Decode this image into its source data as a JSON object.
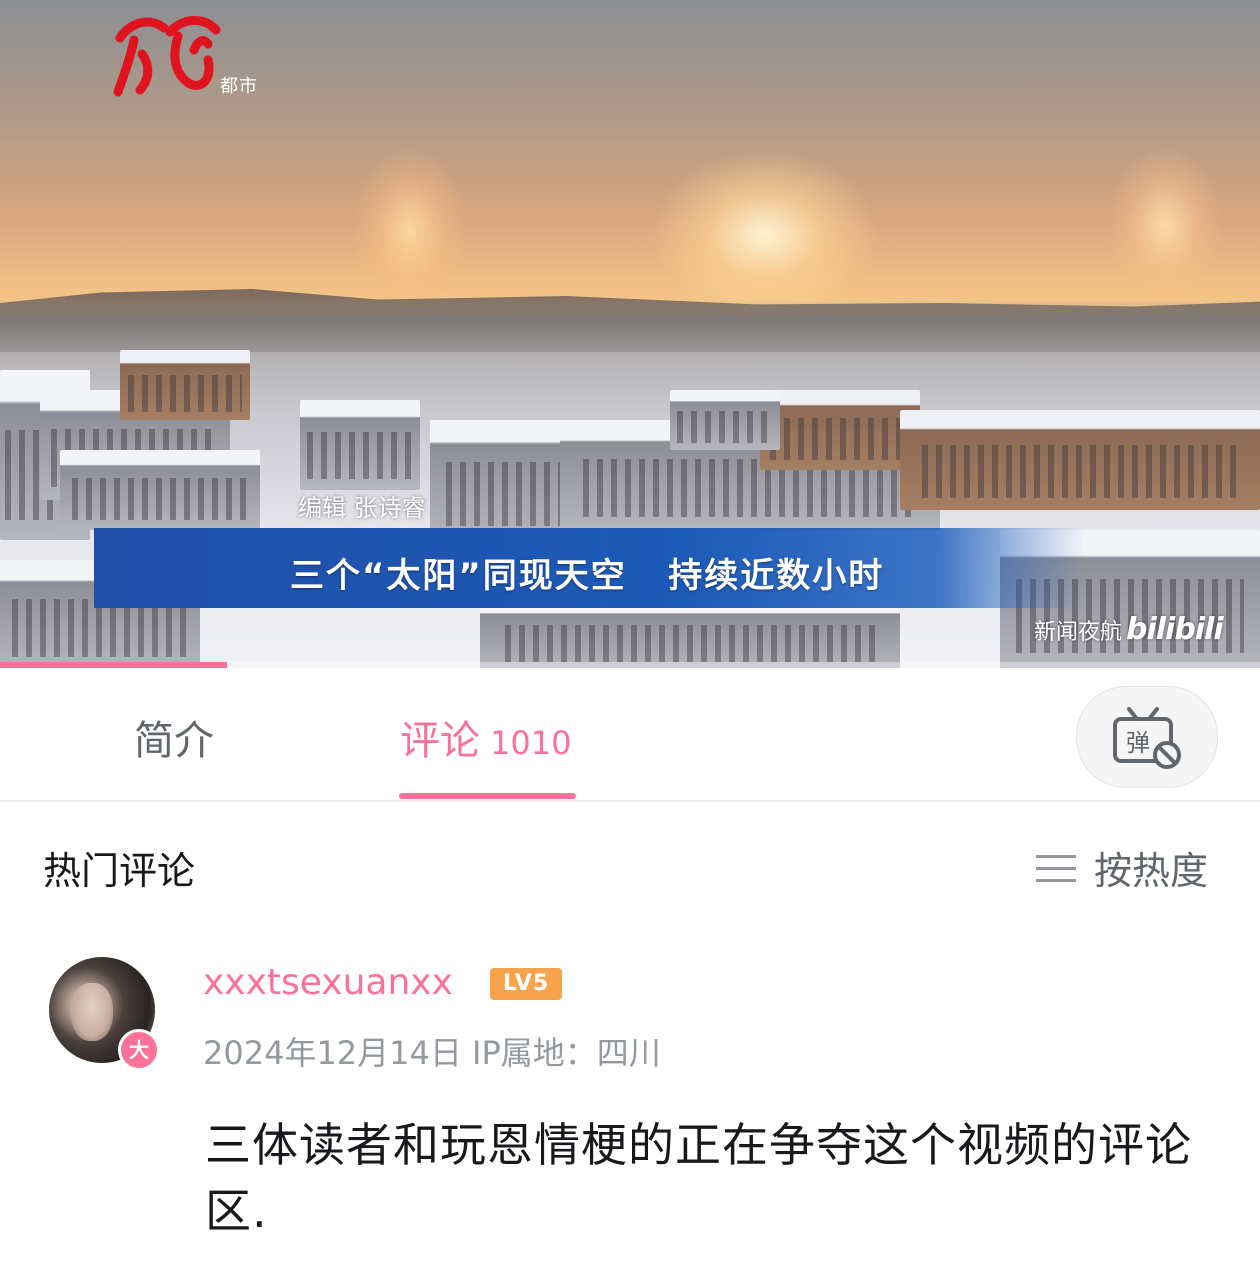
{
  "video": {
    "channel_logo_caption": "都市",
    "editor_credit": "编辑 张诗睿",
    "headline": "三个“太阳”同现天空   持续近数小时",
    "watermark": "新闻夜航",
    "watermark_brand": "bilibili",
    "progress": 0.18
  },
  "tabs": {
    "intro": "简介",
    "comments": "评论",
    "comments_count": "1010",
    "danmaku_icon": "danmaku-off-icon"
  },
  "comments_section": {
    "title": "热门评论",
    "sort_label": "按热度",
    "sort_icon": "menu-lines-icon"
  },
  "comment": {
    "username": "xxxtsexuanxx",
    "level": "LV5",
    "avatar_badge": "大",
    "meta": "2024年12月14日 IP属地：四川",
    "text": "三体读者和玩恩情梗的正在争夺这个视频的评论区."
  },
  "colors": {
    "accent": "#fb7299",
    "level_badge": "#f7a34b",
    "banner_blue": "#1d5bb8",
    "text_primary": "#18191c",
    "text_secondary": "#9499a0"
  }
}
